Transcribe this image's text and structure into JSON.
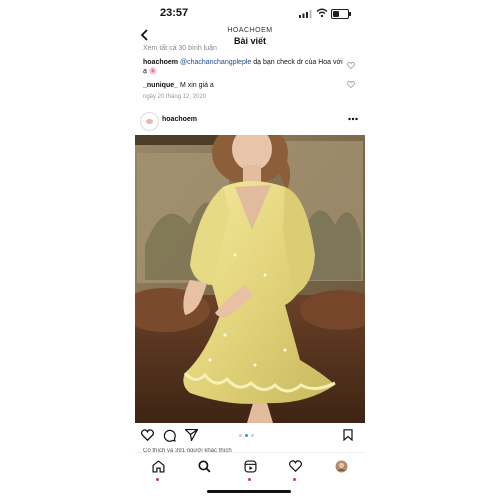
{
  "status": {
    "time": "23:57"
  },
  "header": {
    "account": "HOACHOEM",
    "title": "Bài viết"
  },
  "comments": {
    "view_all": "Xem tất cả 30 bình luận",
    "items": [
      {
        "user": "hoachoem",
        "mention": "@chachanchangpleple",
        "text": " dạ bạn check dr của Hoa với ạ 🌸"
      },
      {
        "user": "_nunique_",
        "text": " M xin giá a"
      }
    ],
    "date": "ngày 20 tháng 12, 2020"
  },
  "post": {
    "username": "hoachoem",
    "likes_text": "Có   thích và 391 người khác thích",
    "image_desc": "woman-in-yellow-dress-photo",
    "pager": {
      "count": 3,
      "active": 2
    }
  },
  "icons": {
    "back": "chevron-left-icon",
    "more": "more-horizontal-icon",
    "like": "heart-icon",
    "comment": "comment-icon",
    "share": "send-icon",
    "save": "bookmark-icon"
  },
  "tabbar": [
    "home-icon",
    "search-icon",
    "reels-icon",
    "activity-icon",
    "profile-avatar"
  ],
  "colors": {
    "mention": "#1f4c89",
    "pager_active": "#3a8ee6",
    "notification": "#e1306c"
  }
}
